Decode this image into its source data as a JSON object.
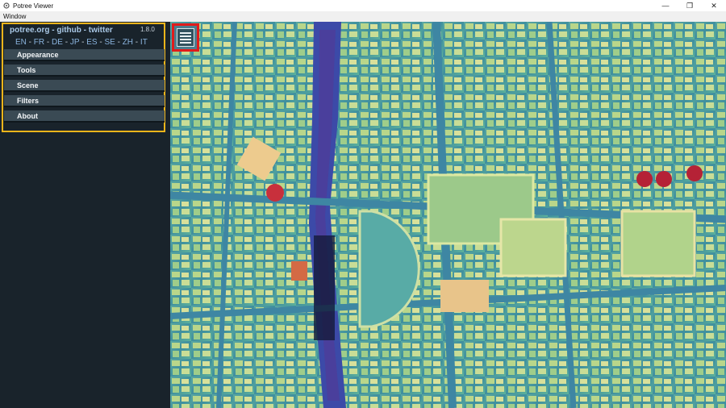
{
  "window": {
    "title": "Potree Viewer",
    "controls": {
      "minimize": "—",
      "restore": "❐",
      "close": "✕"
    }
  },
  "menubar": {
    "items": [
      "Window"
    ]
  },
  "sidebar": {
    "links": {
      "potree": "potree.org",
      "github": "github",
      "twitter": "twitter",
      "separator": " - "
    },
    "version": "1.8.0",
    "languages": [
      "EN",
      "FR",
      "DE",
      "JP",
      "ES",
      "SE",
      "ZH",
      "IT"
    ],
    "menu": [
      {
        "label": "Appearance"
      },
      {
        "label": "Tools"
      },
      {
        "label": "Scene"
      },
      {
        "label": "Filters"
      },
      {
        "label": "About"
      }
    ]
  },
  "viewport": {
    "icon": "menu-toggle-icon"
  },
  "colors": {
    "highlight_border": "#f2b51b",
    "toggle_border": "#e11b1b",
    "sidebar_bg": "#19232b",
    "button_bg": "#3a4a54"
  }
}
